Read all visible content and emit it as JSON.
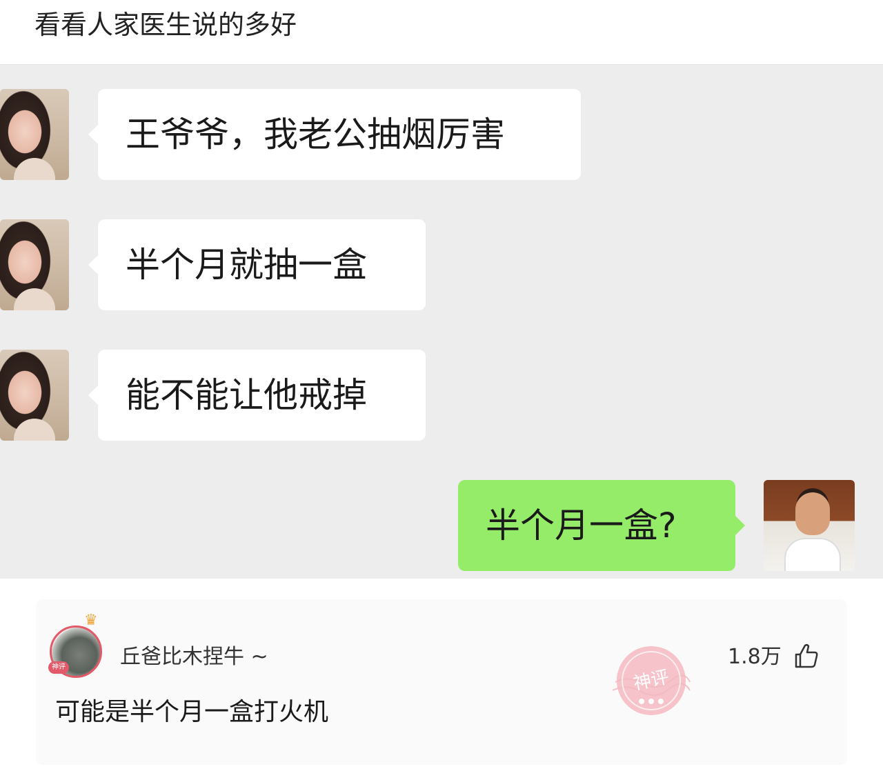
{
  "post": {
    "title": "看看人家医生说的多好"
  },
  "chat": {
    "messages": [
      {
        "side": "left",
        "text": "王爷爷，我老公抽烟厉害"
      },
      {
        "side": "left",
        "text": "半个月就抽一盒"
      },
      {
        "side": "left",
        "text": "能不能让他戒掉"
      },
      {
        "side": "right",
        "text": "半个月一盒?"
      }
    ]
  },
  "comment": {
    "username": "丘爸比木捏牛 ~",
    "likes": "1.8万",
    "text": "可能是半个月一盒打火机",
    "stamp_text": "神评",
    "avatar_badge": "神评",
    "icons": [
      "crown-icon",
      "thumb-up-icon"
    ]
  },
  "colors": {
    "chat_background": "#ededed",
    "left_bubble": "#ffffff",
    "right_bubble": "#95ec69",
    "stamp": "#e25a6a"
  }
}
